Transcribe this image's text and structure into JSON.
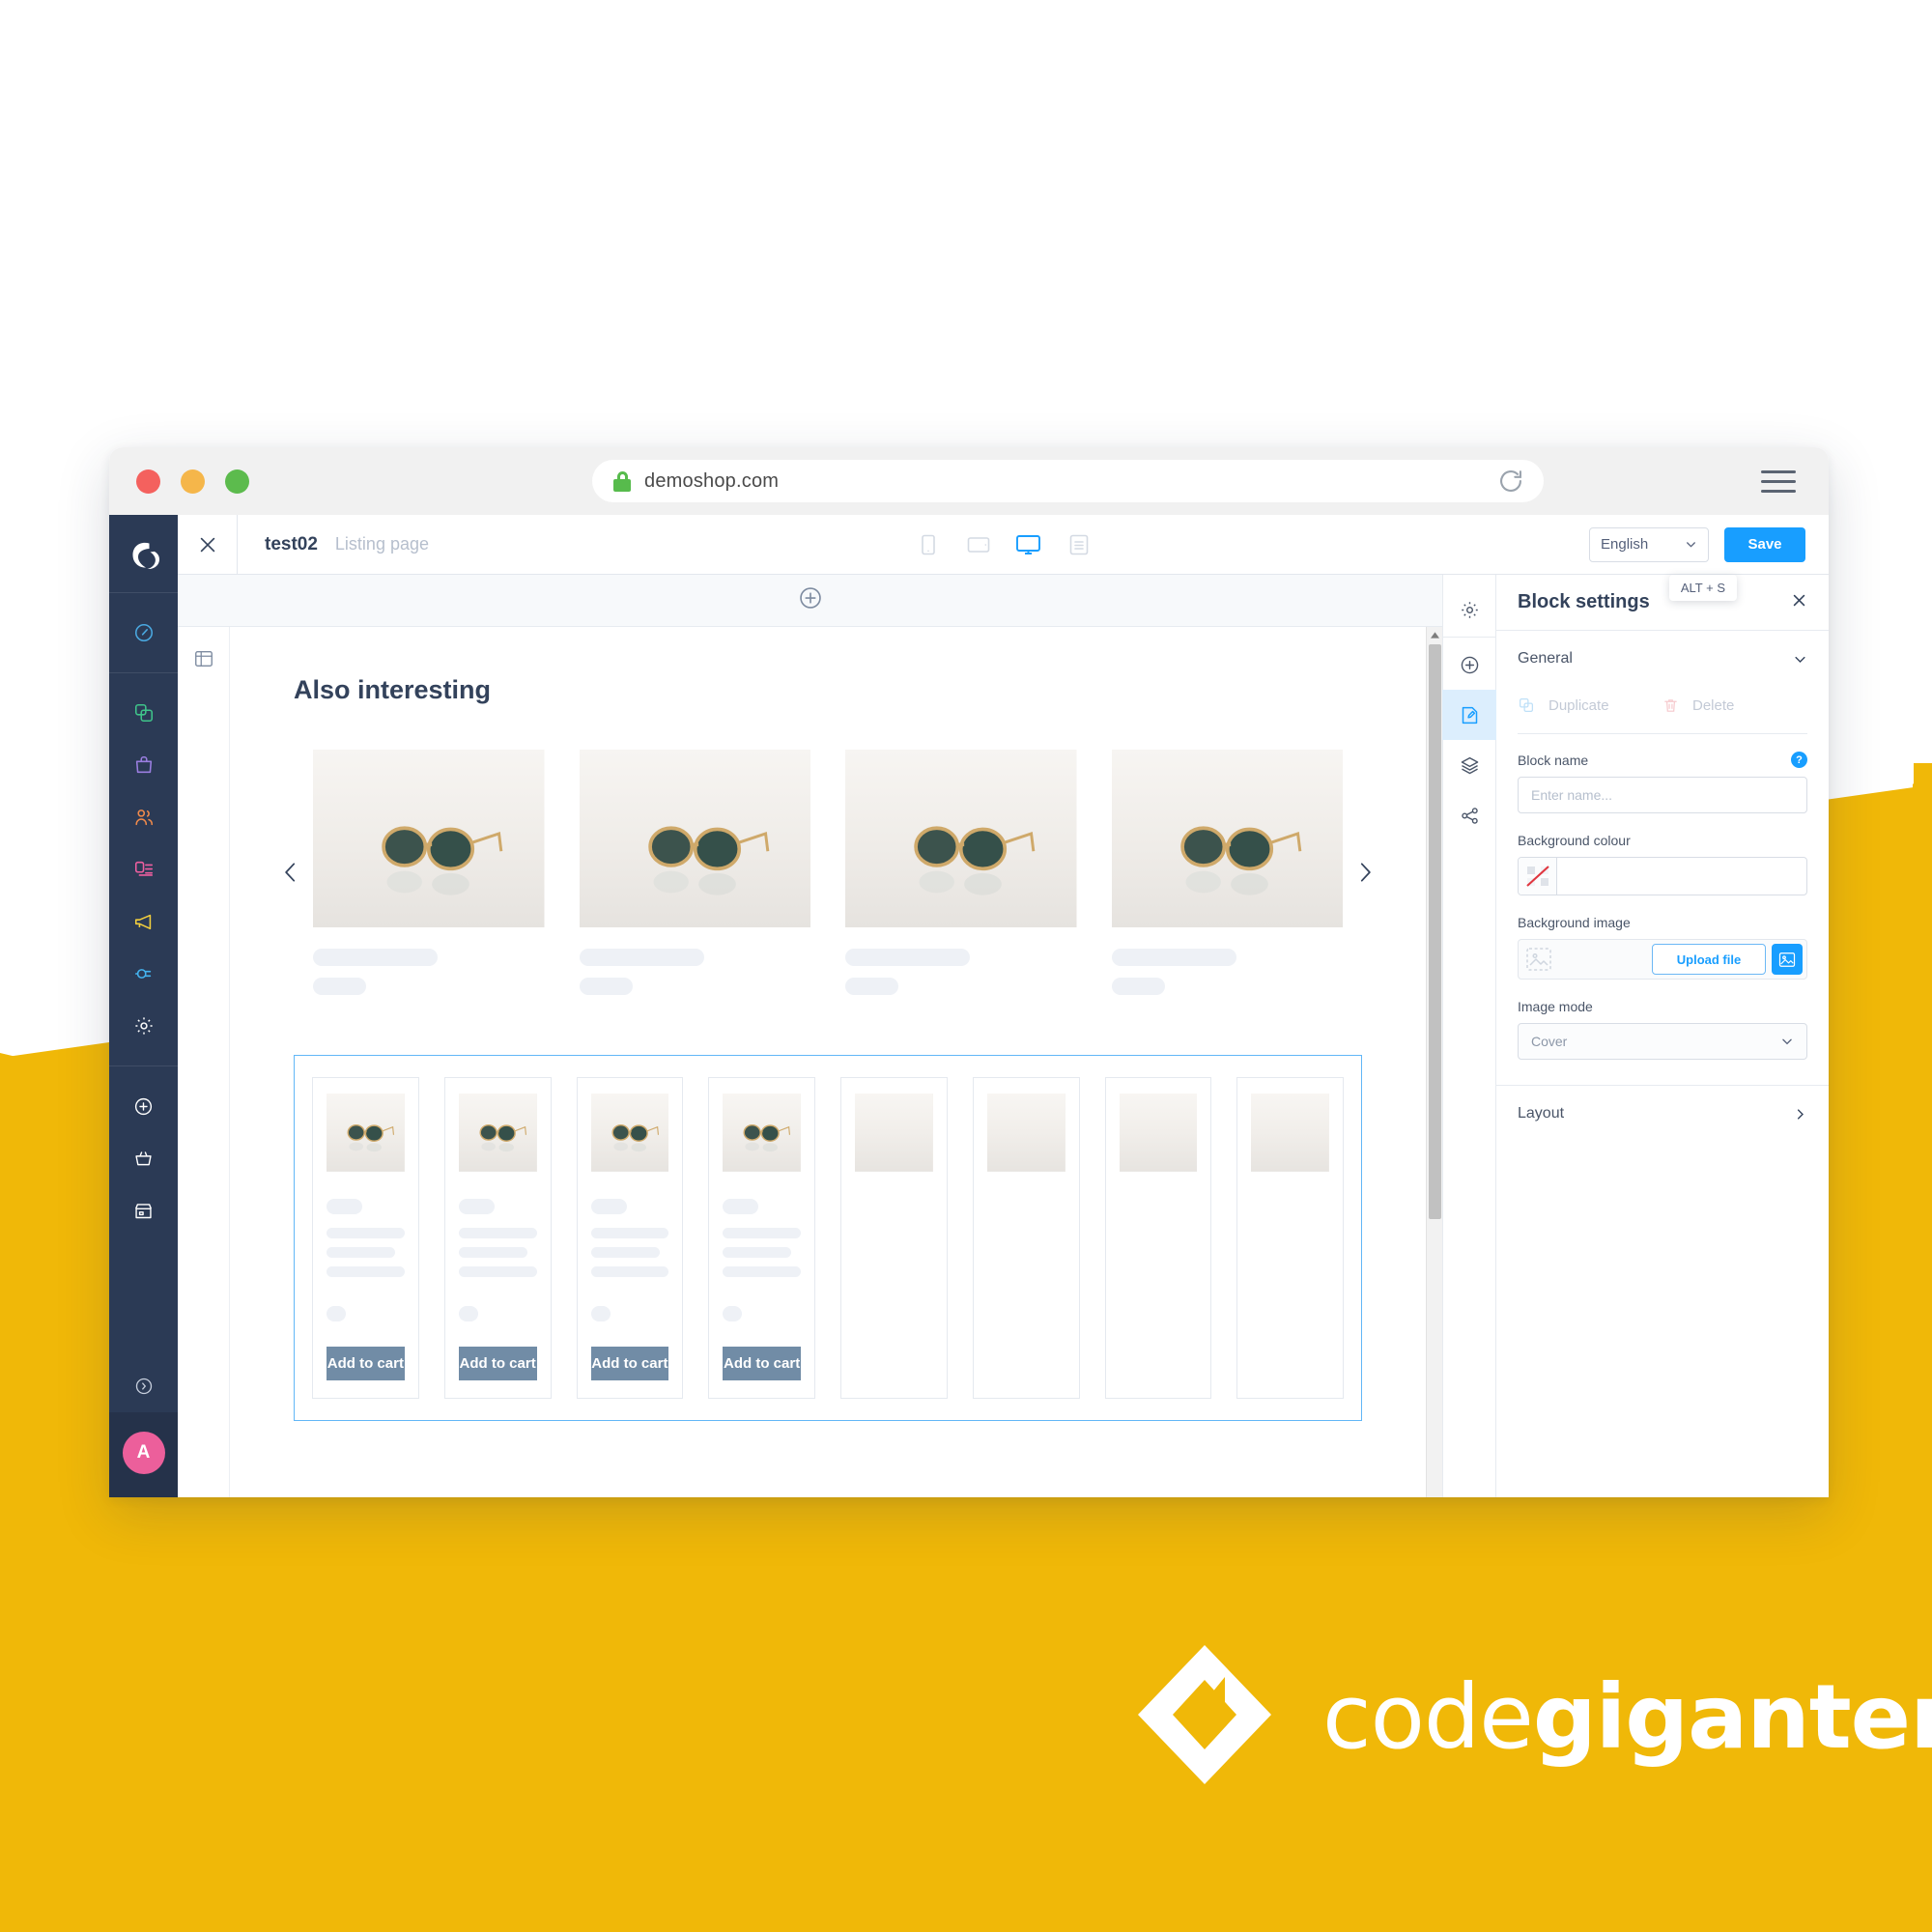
{
  "browser": {
    "url": "demoshop.com",
    "lock_icon": "lock-icon",
    "reload_icon": "reload-icon",
    "menu_icon": "hamburger-menu-icon",
    "traffic_lights": [
      "close-red",
      "minimize-amber",
      "maximize-green"
    ]
  },
  "sidebar": {
    "logo": "shopware-logo",
    "items": [
      {
        "name": "dashboard",
        "icon": "speedometer-icon",
        "color": "#4aa8e0"
      },
      {
        "name": "catalogues",
        "icon": "copy-squares-icon",
        "color": "#3fc48a"
      },
      {
        "name": "orders",
        "icon": "shopping-bag-icon",
        "color": "#9a7ee0"
      },
      {
        "name": "customers",
        "icon": "users-icon",
        "color": "#f08a4b"
      },
      {
        "name": "content",
        "icon": "cms-layout-icon",
        "color": "#ef5fa0"
      },
      {
        "name": "marketing",
        "icon": "megaphone-icon",
        "color": "#f3cf3d"
      },
      {
        "name": "extensions",
        "icon": "plug-icon",
        "color": "#44b4f0"
      },
      {
        "name": "settings",
        "icon": "gear-icon",
        "color": "#ffffff"
      }
    ],
    "quick_items": [
      {
        "name": "add-new",
        "icon": "plus-circle-icon"
      },
      {
        "name": "basket",
        "icon": "basket-icon"
      },
      {
        "name": "storefront",
        "icon": "storefront-icon"
      }
    ],
    "help_icon": "help-circle-icon",
    "avatar_initial": "A",
    "avatar_color": "#ec5f9b"
  },
  "toolbar": {
    "close_icon": "close-x-icon",
    "page_name": "test02",
    "page_type": "Listing page",
    "devices": [
      {
        "name": "mobile",
        "icon": "mobile-icon",
        "active": false
      },
      {
        "name": "tablet",
        "icon": "tablet-icon",
        "active": false
      },
      {
        "name": "desktop",
        "icon": "desktop-icon",
        "active": true
      },
      {
        "name": "fullscreen",
        "icon": "document-lines-icon",
        "active": false
      }
    ],
    "language": "English",
    "language_chevron": "chevron-down-icon",
    "save_label": "Save",
    "save_tooltip": "ALT + S"
  },
  "canvas": {
    "add_block_icon": "plus-circle-icon",
    "left_rail_icon": "layout-sidebar-icon",
    "heading": "Also interesting",
    "carousel": {
      "prev_icon": "chevron-left-icon",
      "next_icon": "chevron-right-icon",
      "item_count": 4
    },
    "product_grid": {
      "selected": true,
      "selection_color": "#62b7f7",
      "card_count": 4,
      "partial_row_count": 4,
      "add_to_cart_label": "Add to cart",
      "button_color": "#718ca6"
    },
    "scrollbar": {
      "up_arrow_icon": "caret-up-icon",
      "thumb_color": "#c1c1c1"
    }
  },
  "right_rail": {
    "items": [
      {
        "name": "settings",
        "icon": "gear-icon",
        "active": false
      },
      {
        "name": "add-section",
        "icon": "plus-circle-icon",
        "active": false
      },
      {
        "name": "block-settings",
        "icon": "edit-block-icon",
        "active": true
      },
      {
        "name": "layers",
        "icon": "layers-icon",
        "active": false
      },
      {
        "name": "share",
        "icon": "share-nodes-icon",
        "active": false
      }
    ]
  },
  "panel": {
    "title": "Block settings",
    "close_icon": "close-x-icon",
    "general": {
      "title": "General",
      "chevron_icon": "chevron-down-icon",
      "duplicate_label": "Duplicate",
      "duplicate_icon": "duplicate-icon",
      "delete_label": "Delete",
      "delete_icon": "trash-icon",
      "block_name_label": "Block name",
      "block_name_help": "?",
      "block_name_placeholder": "Enter name...",
      "block_name_value": "",
      "background_colour_label": "Background colour",
      "background_colour_value": "",
      "background_colour_swatch": "transparent-swatch-icon",
      "background_image_label": "Background image",
      "background_image_placeholder_icon": "image-placeholder-icon",
      "upload_label": "Upload file",
      "media_picker_icon": "image-icon",
      "image_mode_label": "Image mode",
      "image_mode_value": "Cover",
      "image_mode_chevron": "chevron-down-icon"
    },
    "layout": {
      "title": "Layout",
      "chevron_icon": "chevron-right-icon"
    }
  },
  "brand": {
    "logo_icon": "codegiganten-mark",
    "word_light": "code",
    "word_bold": "giganten",
    "background": "#F0B808"
  }
}
